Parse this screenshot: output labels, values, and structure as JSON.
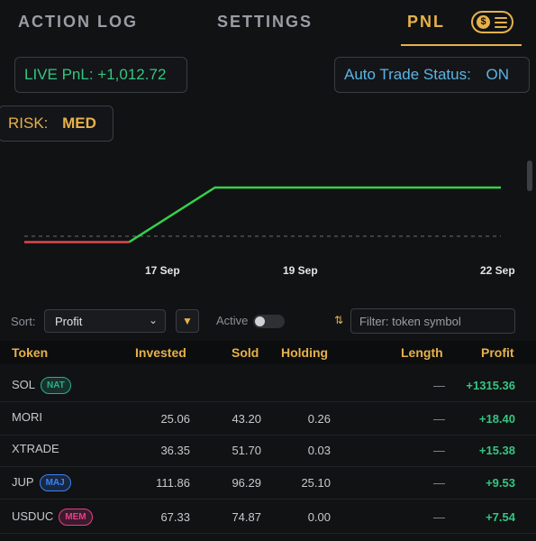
{
  "tabs": {
    "action_log": "ACTION LOG",
    "settings": "SETTINGS",
    "pnl": "PNL",
    "coin_symbol": "$"
  },
  "status": {
    "live_label": "LIVE PnL:",
    "live_value": "+1,012.72",
    "auto_label": "Auto Trade Status:",
    "auto_value": "ON",
    "risk_label": "RISK:",
    "risk_value": "MED"
  },
  "chart_data": {
    "type": "line",
    "x_ticks": [
      "17 Sep",
      "19 Sep",
      "22 Sep"
    ],
    "baseline_dashed": true,
    "segments": [
      {
        "color": "#e0474c",
        "points": [
          [
            0,
            -0.12
          ],
          [
            0.22,
            -0.12
          ]
        ]
      },
      {
        "color": "#36d04a",
        "points": [
          [
            0.22,
            -0.12
          ],
          [
            0.4,
            1.0
          ],
          [
            1.0,
            1.0
          ]
        ]
      }
    ]
  },
  "controls": {
    "sort_label": "Sort:",
    "sort_value": "Profit",
    "sort_dir_icon": "triangle-down",
    "active_label": "Active",
    "filter_placeholder": "Filter: token symbol"
  },
  "table": {
    "headers": {
      "token": "Token",
      "invested": "Invested",
      "sold": "Sold",
      "holding": "Holding",
      "length": "Length",
      "profit": "Profit"
    },
    "rows": [
      {
        "token": "SOL",
        "badge": "NAT",
        "badge_color": "#2fae87",
        "invested": "",
        "sold": "",
        "holding": "",
        "length": "—",
        "profit": "+1315.36"
      },
      {
        "token": "MORI",
        "badge": "",
        "badge_color": "",
        "invested": "25.06",
        "sold": "43.20",
        "holding": "0.26",
        "length": "—",
        "profit": "+18.40"
      },
      {
        "token": "XTRADE",
        "badge": "",
        "badge_color": "",
        "invested": "36.35",
        "sold": "51.70",
        "holding": "0.03",
        "length": "—",
        "profit": "+15.38"
      },
      {
        "token": "JUP",
        "badge": "MAJ",
        "badge_color": "#3b82f6",
        "invested": "111.86",
        "sold": "96.29",
        "holding": "25.10",
        "length": "—",
        "profit": "+9.53"
      },
      {
        "token": "USDUC",
        "badge": "MEM",
        "badge_color": "#e83e8c",
        "invested": "67.33",
        "sold": "74.87",
        "holding": "0.00",
        "length": "—",
        "profit": "+7.54"
      }
    ]
  }
}
